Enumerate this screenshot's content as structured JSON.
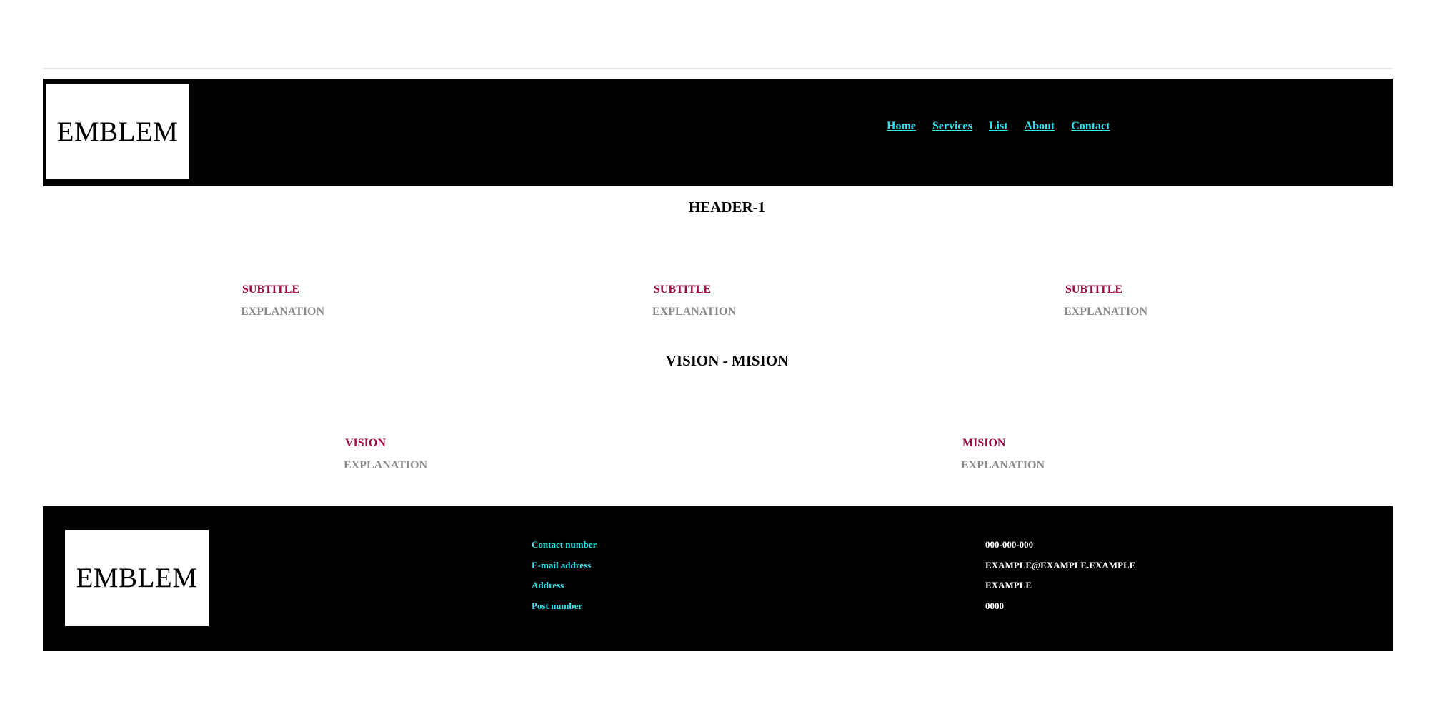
{
  "header": {
    "emblem": "EMBLEM",
    "nav": [
      "Home",
      "Services",
      "List",
      "About",
      "Contact"
    ]
  },
  "section1": {
    "title": "HEADER-1",
    "items": [
      {
        "subtitle": "SUBTITLE",
        "explanation": "EXPLANATION"
      },
      {
        "subtitle": "SUBTITLE",
        "explanation": "EXPLANATION"
      },
      {
        "subtitle": "SUBTITLE",
        "explanation": "EXPLANATION"
      }
    ]
  },
  "section2": {
    "title": "VISION - MISION",
    "vision": {
      "subtitle": "VISION",
      "explanation": "EXPLANATION"
    },
    "mision": {
      "subtitle": "MISION",
      "explanation": "EXPLANATION"
    }
  },
  "footer": {
    "emblem": "EMBLEM",
    "labels": [
      "Contact number",
      "E-mail address",
      "Address",
      "Post number"
    ],
    "values": [
      "000-000-000",
      "EXAMPLE@EXAMPLE.EXAMPLE",
      "EXAMPLE",
      "0000"
    ]
  },
  "colors": {
    "nav_link": "#29e8ee",
    "subtitle": "#9c0a45",
    "explanation": "#8a8a8a",
    "bar_background": "#000000"
  }
}
